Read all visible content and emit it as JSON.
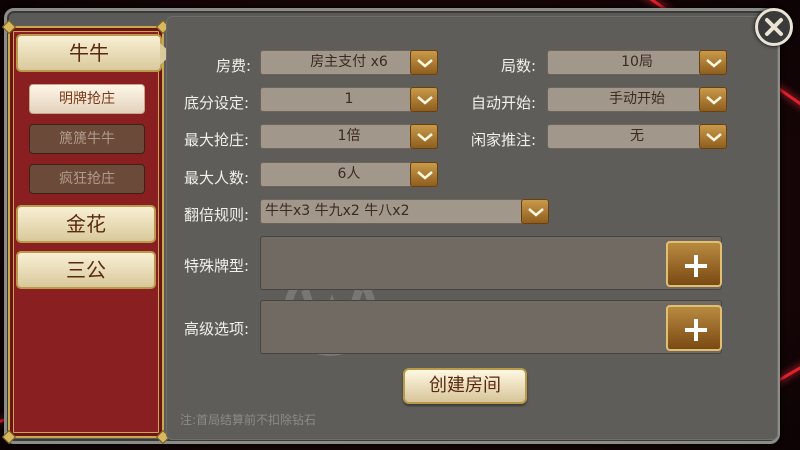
{
  "categories": [
    {
      "label": "牛牛",
      "active": true
    },
    {
      "label": "金花",
      "active": false
    },
    {
      "label": "三公",
      "active": false
    }
  ],
  "sub_modes": [
    {
      "label": "明牌抢庄",
      "active": true
    },
    {
      "label": "篪篪牛牛",
      "active": false
    },
    {
      "label": "疯狂抢庄",
      "active": false
    }
  ],
  "form": {
    "room_fee": {
      "label": "房费:",
      "value": "房主支付 x6"
    },
    "rounds": {
      "label": "局数:",
      "value": "10局"
    },
    "base_score": {
      "label": "底分设定:",
      "value": "1"
    },
    "auto_start": {
      "label": "自动开始:",
      "value": "手动开始"
    },
    "max_bank": {
      "label": "最大抢庄:",
      "value": "1倍"
    },
    "player_bet": {
      "label": "闲家推注:",
      "value": "无"
    },
    "max_players": {
      "label": "最大人数:",
      "value": "6人"
    },
    "multiplier_rule": {
      "label": "翻倍规则:",
      "value": "牛牛x3  牛九x2  牛八x2"
    },
    "special_hands": {
      "label": "特殊牌型:"
    },
    "advanced_options": {
      "label": "高级选项:"
    }
  },
  "create_room_label": "创建房间",
  "footer_note": "注:首局结算前不扣除钻石",
  "icons": {
    "close": "close-icon",
    "dropdown": "chevron-down-icon",
    "add": "plus-icon"
  },
  "colors": {
    "sidebar": "#8a1f22",
    "panel": "#5e5d5a",
    "gold": "#c89a4a",
    "cream": "#f8f0d4"
  }
}
